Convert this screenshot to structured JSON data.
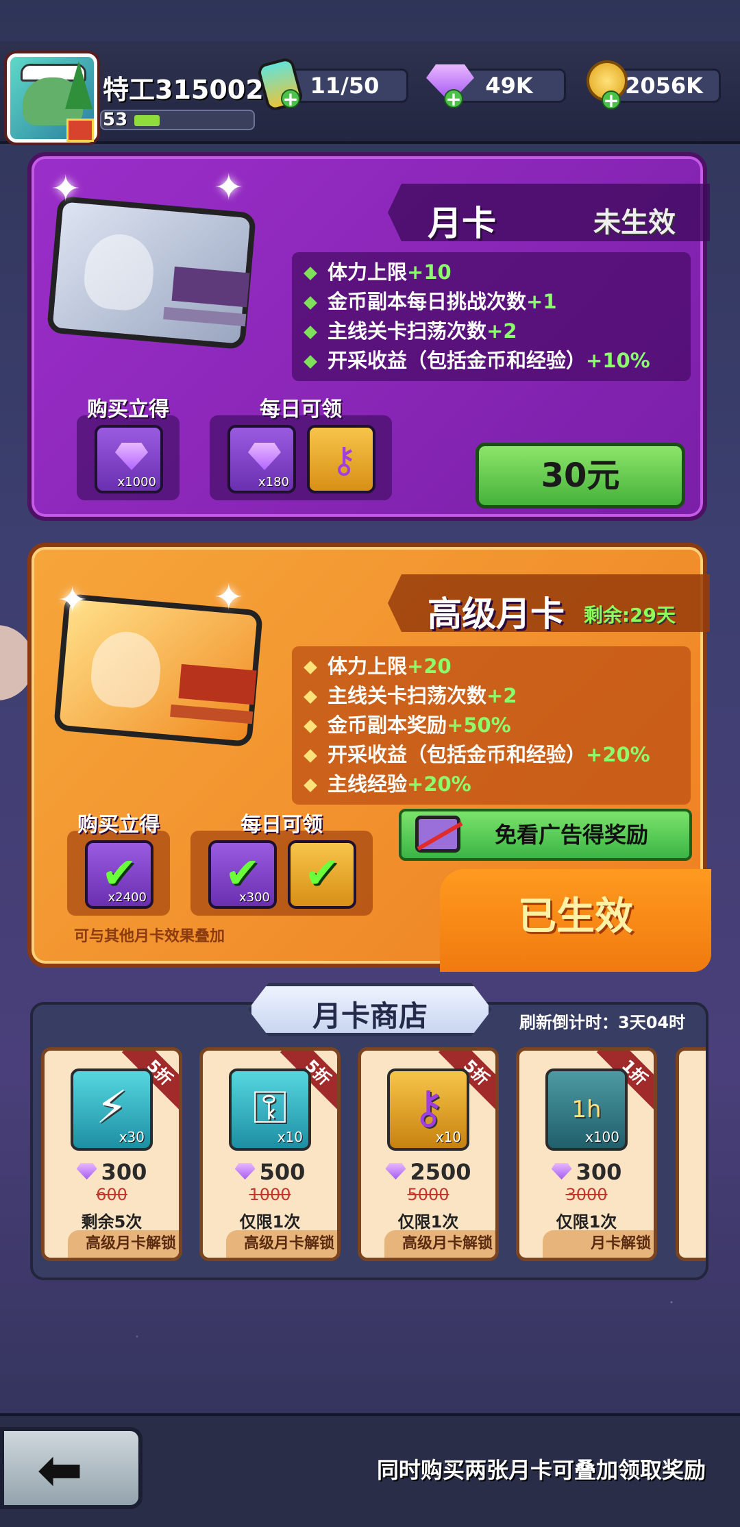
{
  "header": {
    "player_name": "特工315002",
    "level": "53",
    "level_progress": 0.22,
    "stamina": "11/50",
    "gems": "49K",
    "gold": "2056K"
  },
  "monthly_card": {
    "title": "月卡",
    "status": "未生效",
    "benefits": [
      {
        "text": "体力上限",
        "bonus": "+10"
      },
      {
        "text": "金币副本每日挑战次数",
        "bonus": "+1"
      },
      {
        "text": "主线关卡扫荡次数",
        "bonus": "+2"
      },
      {
        "text": "开采收益（包括金币和经验）",
        "bonus": "+10%"
      }
    ],
    "instant_label": "购买立得",
    "instant_qty": "x1000",
    "daily_label": "每日可领",
    "daily_qty": "x180",
    "price": "30元"
  },
  "premium_card": {
    "title": "高级月卡",
    "status": "剩余:29天",
    "benefits": [
      {
        "text": "体力上限",
        "bonus": "+20"
      },
      {
        "text": "主线关卡扫荡次数",
        "bonus": "+2"
      },
      {
        "text": "金币副本奖励",
        "bonus": "+50%"
      },
      {
        "text": "开采收益（包括金币和经验）",
        "bonus": "+20%"
      },
      {
        "text": "主线经验",
        "bonus": "+20%"
      }
    ],
    "instant_label": "购买立得",
    "instant_qty": "x2400",
    "daily_label": "每日可领",
    "daily_qty": "x300",
    "ad_label": "免看广告得奖励",
    "active_label": "已生效",
    "note": "可与其他月卡效果叠加"
  },
  "shop": {
    "title": "月卡商店",
    "refresh": "刷新倒计时：3天04时",
    "items": [
      {
        "discount": "5折",
        "qty": "x30",
        "price": "300",
        "old_price": "600",
        "limit": "剩余5次",
        "unlock": "高级月卡解锁",
        "icon": "battery-icon"
      },
      {
        "discount": "5折",
        "qty": "x10",
        "price": "500",
        "old_price": "1000",
        "limit": "仅限1次",
        "unlock": "高级月卡解锁",
        "icon": "silver-key-icon"
      },
      {
        "discount": "5折",
        "qty": "x10",
        "price": "2500",
        "old_price": "5000",
        "limit": "仅限1次",
        "unlock": "高级月卡解锁",
        "icon": "gold-key-icon"
      },
      {
        "discount": "1折",
        "qty": "x100",
        "price": "300",
        "old_price": "3000",
        "limit": "仅限1次",
        "unlock": "月卡解锁",
        "icon": "gold-bag-icon",
        "bag_label": "1h"
      }
    ]
  },
  "footer": {
    "tip": "同时购买两张月卡可叠加领取奖励"
  }
}
